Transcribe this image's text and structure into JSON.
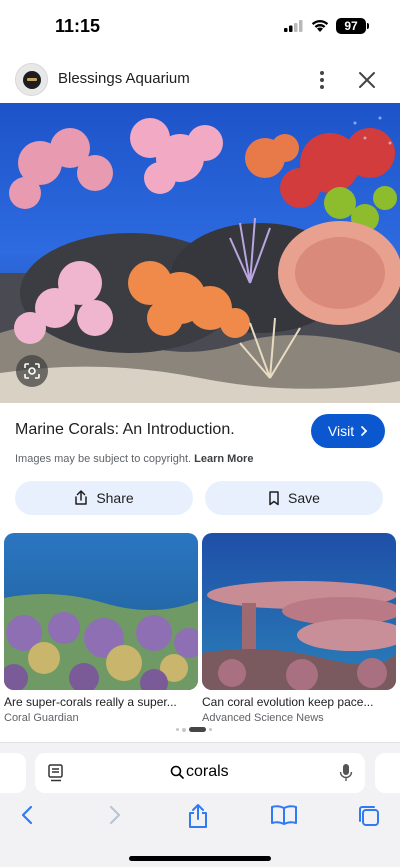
{
  "status_bar": {
    "time": "11:15",
    "battery": "97"
  },
  "header": {
    "site_name": "Blessings Aquarium"
  },
  "hero": {
    "alt": "Colorful coral reef aquarium"
  },
  "result": {
    "title": "Marine Corals: An Introduction.",
    "visit_label": "Visit",
    "copyright_text": "Images may be subject to copyright.",
    "learn_more": "Learn More"
  },
  "actions": {
    "share_label": "Share",
    "save_label": "Save"
  },
  "related": [
    {
      "caption": "Are super-corals really a super...",
      "source": "Coral Guardian"
    },
    {
      "caption": "Can coral evolution keep pace...",
      "source": "Advanced Science News"
    }
  ],
  "browser": {
    "query": "corals"
  },
  "colors": {
    "accent": "#0b57d0",
    "pill": "#e8f0fe",
    "ios_blue": "#2f7bf5"
  }
}
